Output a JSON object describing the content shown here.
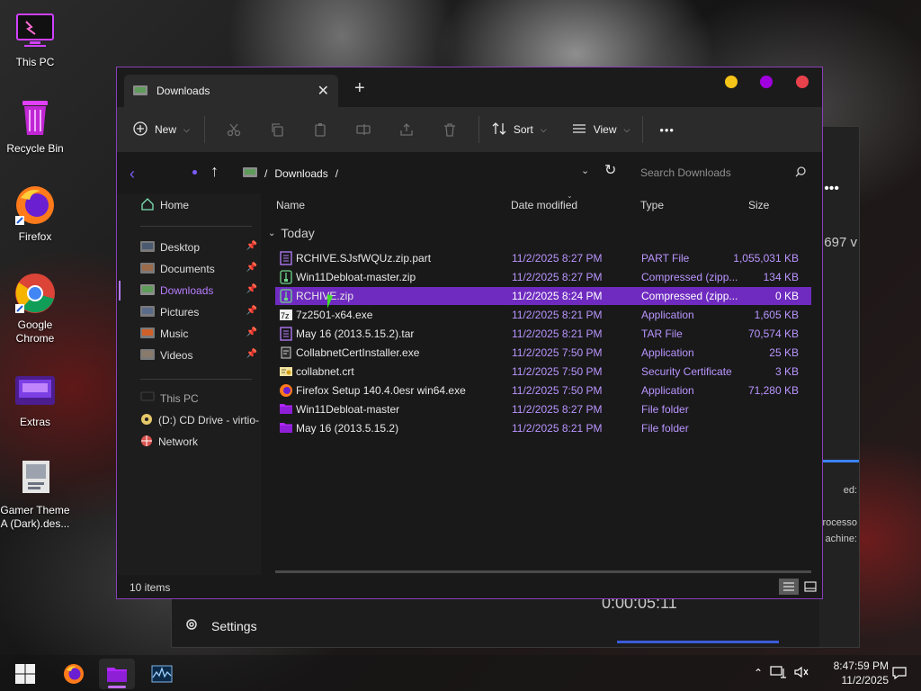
{
  "desktop": {
    "icons": [
      {
        "label": "This PC"
      },
      {
        "label": "Recycle Bin"
      },
      {
        "label": "Firefox"
      },
      {
        "label": "Google Chrome"
      },
      {
        "label": "Extras"
      },
      {
        "label": "Gamer Theme A (Dark).des..."
      }
    ]
  },
  "background_window": {
    "settings_label": "Settings",
    "timer": "0:00:05:11",
    "partial_texts": [
      "697 v",
      "ed:",
      "rocesso",
      "achine:"
    ]
  },
  "explorer": {
    "tab_title": "Downloads",
    "toolbar": {
      "new_label": "New",
      "sort_label": "Sort",
      "view_label": "View",
      "more_label": "•••"
    },
    "address": {
      "path": "Downloads",
      "separator": "/",
      "search_placeholder": "Search Downloads"
    },
    "nav": {
      "home": "Home",
      "quick": [
        "Desktop",
        "Documents",
        "Downloads",
        "Pictures",
        "Music",
        "Videos"
      ],
      "this_pc": "This PC",
      "drive": "(D:) CD Drive - virtio-",
      "network": "Network"
    },
    "columns": {
      "name": "Name",
      "date": "Date modified",
      "type": "Type",
      "size": "Size"
    },
    "group_label": "Today",
    "files": [
      {
        "name": "RCHIVE.SJsfWQUz.zip.part",
        "date": "11/2/2025 8:27 PM",
        "type": "PART File",
        "size": "1,055,031 KB",
        "icon": "doc-icon"
      },
      {
        "name": "Win11Debloat-master.zip",
        "date": "11/2/2025 8:27 PM",
        "type": "Compressed (zipp...",
        "size": "134 KB",
        "icon": "zip-icon"
      },
      {
        "name": "RCHIVE.zip",
        "date": "11/2/2025 8:24 PM",
        "type": "Compressed (zipp...",
        "size": "0 KB",
        "icon": "zip-icon",
        "selected": true
      },
      {
        "name": "7z2501-x64.exe",
        "date": "11/2/2025 8:21 PM",
        "type": "Application",
        "size": "1,605 KB",
        "icon": "7z-icon"
      },
      {
        "name": "May 16 (2013.5.15.2).tar",
        "date": "11/2/2025 8:21 PM",
        "type": "TAR File",
        "size": "70,574 KB",
        "icon": "doc-icon"
      },
      {
        "name": "CollabnetCertInstaller.exe",
        "date": "11/2/2025 7:50 PM",
        "type": "Application",
        "size": "25 KB",
        "icon": "exe-icon"
      },
      {
        "name": "collabnet.crt",
        "date": "11/2/2025 7:50 PM",
        "type": "Security Certificate",
        "size": "3 KB",
        "icon": "cert-icon"
      },
      {
        "name": "Firefox Setup 140.4.0esr win64.exe",
        "date": "11/2/2025 7:50 PM",
        "type": "Application",
        "size": "71,280 KB",
        "icon": "firefox-icon"
      },
      {
        "name": "Win11Debloat-master",
        "date": "11/2/2025 8:27 PM",
        "type": "File folder",
        "size": "",
        "icon": "folder-icon"
      },
      {
        "name": "May 16 (2013.5.15.2)",
        "date": "11/2/2025 8:21 PM",
        "type": "File folder",
        "size": "",
        "icon": "folder-icon"
      }
    ],
    "status": "10 items"
  },
  "taskbar": {
    "time": "8:47:59 PM",
    "date": "11/2/2025"
  },
  "colors": {
    "accent": "#b77dff",
    "selection": "#6f2bc0",
    "border": "#8a3fb8",
    "dot_yellow": "#f5c518",
    "dot_purple": "#a100e0",
    "dot_red": "#e8424c"
  }
}
